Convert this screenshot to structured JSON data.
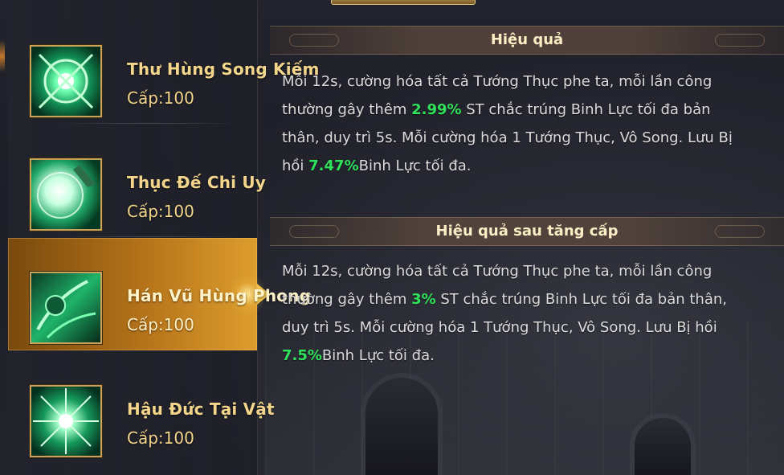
{
  "colors": {
    "highlight": "#2fe25a",
    "title_gold": "#f3d58b",
    "body_text": "#dcdcdc"
  },
  "skills": [
    {
      "name": "Thư Hùng Song Kiếm",
      "level": "Cấp:100",
      "icon": "twin-swords-burst-icon"
    },
    {
      "name": "Thục Đế Chi Uy",
      "level": "Cấp:100",
      "icon": "green-orb-icon"
    },
    {
      "name": "Hán Vũ Hùng Phong",
      "level": "Cấp:100",
      "icon": "green-warrior-icon",
      "selected": true
    },
    {
      "name": "Hậu Đức Tại Vật",
      "level": "Cấp:100",
      "icon": "green-explosion-icon"
    }
  ],
  "effect": {
    "title": "Hiệu quả",
    "p1": "Mỗi 12s, cường hóa tất cả Tướng Thục phe ta, mỗi lần công thường gây thêm ",
    "v1": "2.99%",
    "p2": " ST chắc trúng Binh Lực tối đa bản thân, duy trì 5s. Mỗi cường hóa 1 Tướng Thục, Vô Song. Lưu Bị hồi ",
    "v2": "7.47%",
    "p3": "Binh Lực tối đa."
  },
  "upgrade": {
    "title": "Hiệu quả sau tăng cấp",
    "p1": "Mỗi 12s, cường hóa tất cả Tướng Thục phe ta, mỗi lần công thường gây thêm ",
    "v1": "3%",
    "p2": " ST chắc trúng Binh Lực tối đa bản thân, duy trì 5s. Mỗi cường hóa 1 Tướng Thục, Vô Song. Lưu Bị hồi ",
    "v2": "7.5%",
    "p3": "Binh Lực tối đa."
  }
}
